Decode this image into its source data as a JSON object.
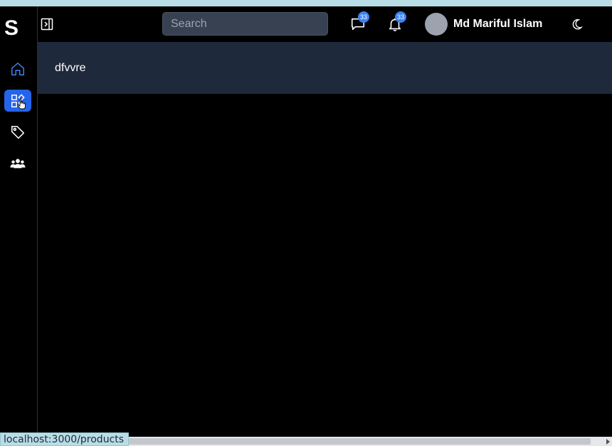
{
  "app": {
    "logo_letter": "S"
  },
  "sidebar": {
    "items": [
      {
        "name": "home",
        "icon": "home-icon",
        "active": false
      },
      {
        "name": "products",
        "icon": "grid-icon",
        "active": true
      },
      {
        "name": "tags",
        "icon": "tag-icon",
        "active": false
      },
      {
        "name": "users",
        "icon": "users-icon",
        "active": false
      }
    ]
  },
  "header": {
    "search_placeholder": "Search",
    "messages_count": "33",
    "notifications_count": "33",
    "user_name": "Md Mariful Islam"
  },
  "main": {
    "card_text": "dfvvre"
  },
  "status_bar": {
    "url": "localhost:3000/products"
  },
  "colors": {
    "accent": "#2563eb",
    "badge": "#3b82f6",
    "card_bg": "#1e293b",
    "page_bg": "#000000"
  }
}
